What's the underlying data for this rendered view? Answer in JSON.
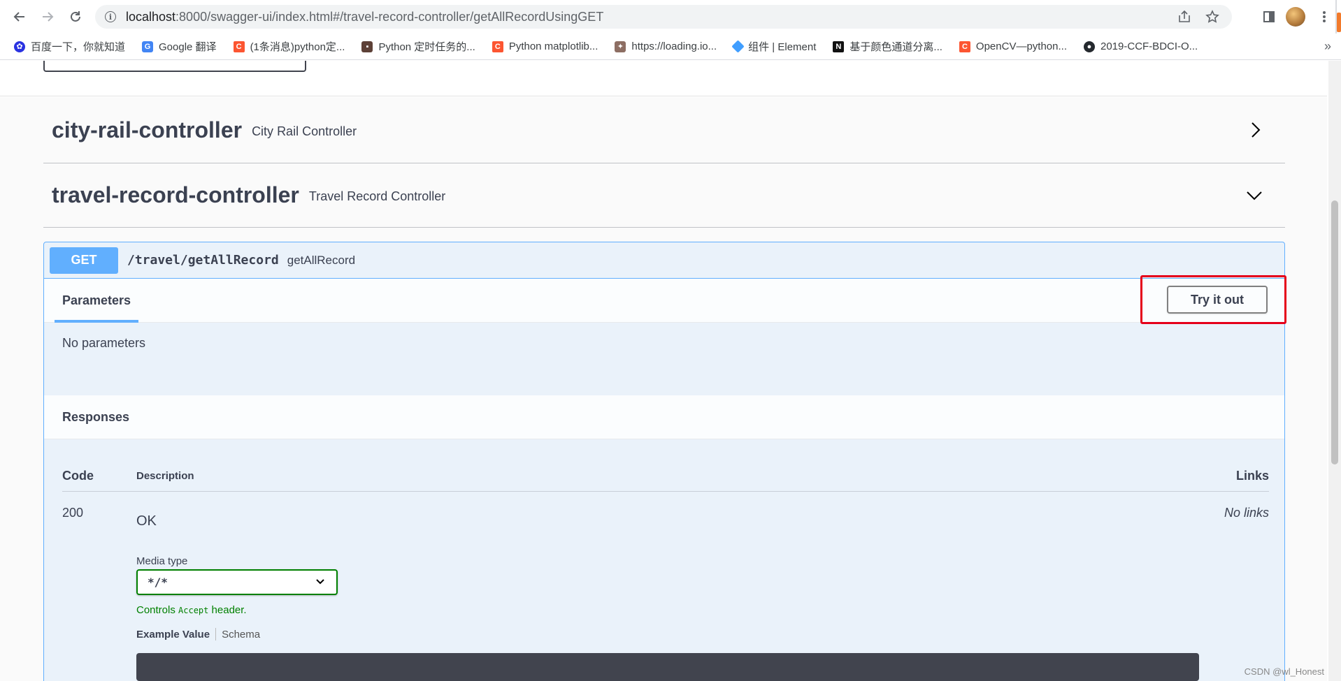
{
  "browser": {
    "url_host": "localhost",
    "url_rest": ":8000/swagger-ui/index.html#/travel-record-controller/getAllRecordUsingGET",
    "bookmarks": [
      {
        "icon": "baidu-icon",
        "label": "百度一下，你就知道"
      },
      {
        "icon": "google-translate-icon",
        "label": "Google 翻译"
      },
      {
        "icon": "csdn-icon",
        "label": "(1条消息)python定..."
      },
      {
        "icon": "camera-icon",
        "label": "Python 定时任务的..."
      },
      {
        "icon": "csdn-icon",
        "label": "Python matplotlib..."
      },
      {
        "icon": "loading-icon",
        "label": "https://loading.io..."
      },
      {
        "icon": "element-icon",
        "label": "组件 | Element"
      },
      {
        "icon": "n-icon",
        "label": "基于颜色通道分离..."
      },
      {
        "icon": "csdn-icon",
        "label": "OpenCV—python..."
      },
      {
        "icon": "github-icon",
        "label": "2019-CCF-BDCI-O..."
      }
    ],
    "more_bookmarks": "»"
  },
  "tags": [
    {
      "name": "city-rail-controller",
      "description": "City Rail Controller",
      "expanded": false
    },
    {
      "name": "travel-record-controller",
      "description": "Travel Record Controller",
      "expanded": true
    }
  ],
  "operation": {
    "method": "GET",
    "path": "/travel/getAllRecord",
    "summary": "getAllRecord",
    "parameters_tab": "Parameters",
    "try_it_out": "Try it out",
    "no_parameters": "No parameters",
    "responses_title": "Responses",
    "responses": {
      "headers": {
        "code": "Code",
        "description": "Description",
        "links": "Links"
      },
      "rows": [
        {
          "code": "200",
          "description": "OK",
          "links": "No links"
        }
      ],
      "media_type_label": "Media type",
      "media_type_value": "*/*",
      "controls_prefix": "Controls ",
      "controls_code": "Accept",
      "controls_suffix": " header.",
      "example_tab": "Example Value",
      "schema_tab": "Schema"
    }
  },
  "watermark": "CSDN @wl_Honest",
  "colors": {
    "get_accent": "#61affe",
    "highlight": "#e5001a",
    "media_border": "#008000",
    "text": "#3b4151"
  }
}
